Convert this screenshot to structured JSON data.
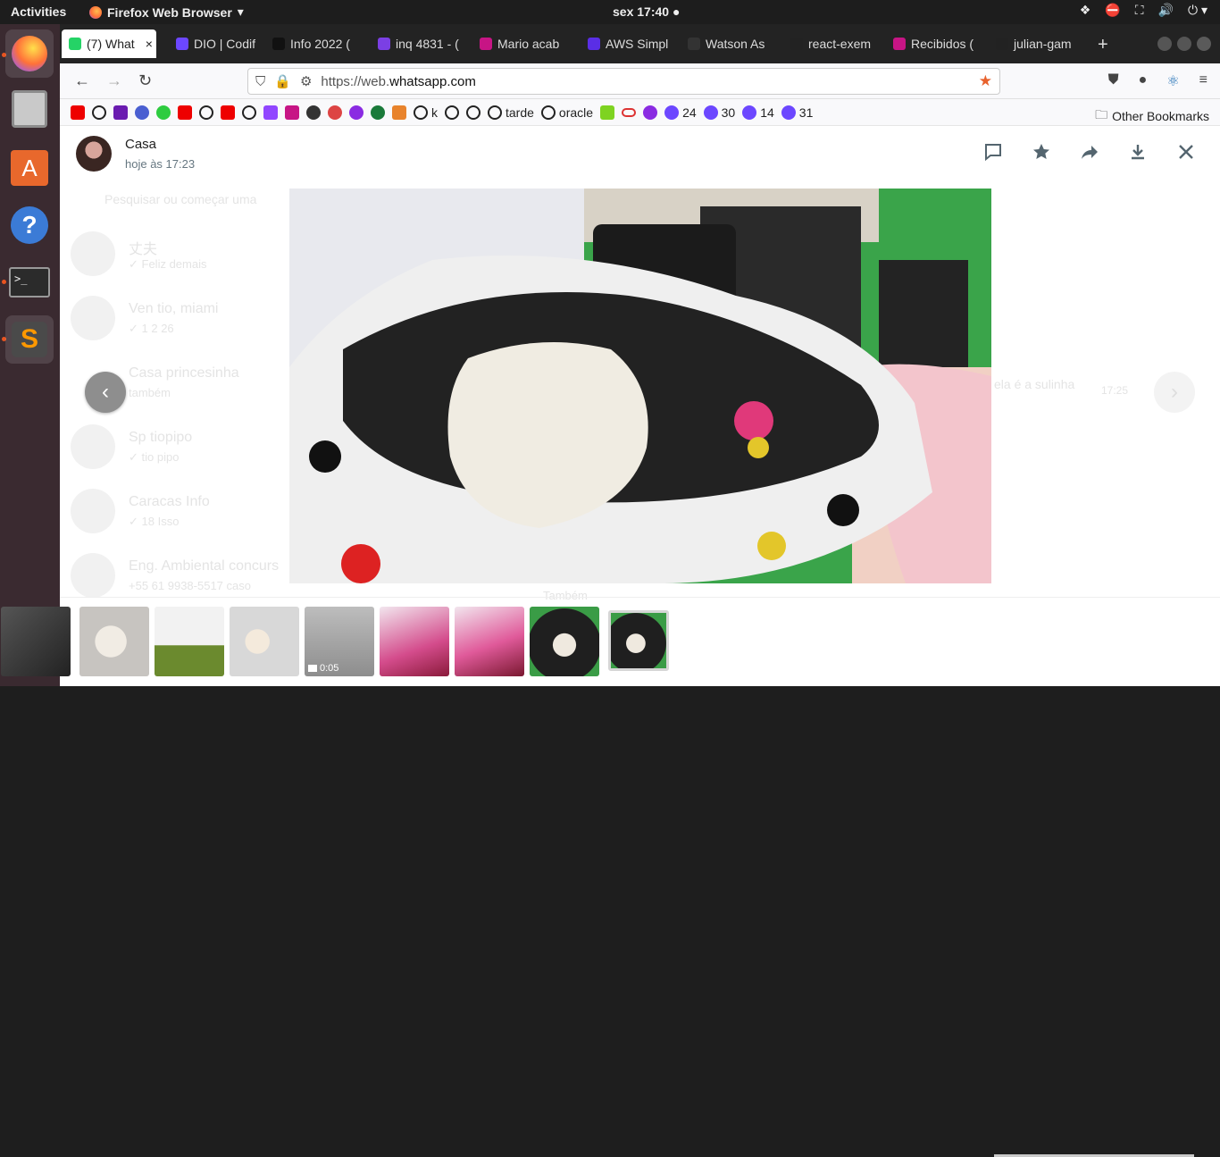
{
  "topbar": {
    "activities": "Activities",
    "app_name": "Firefox Web Browser",
    "clock": "sex 17:40"
  },
  "tabs": [
    {
      "label": "(7) What",
      "color": "#25d366"
    },
    {
      "label": "DIO | Codif",
      "color": "#6c47ff"
    },
    {
      "label": "Info 2022 (",
      "color": "#111111"
    },
    {
      "label": "inq 4831 - (",
      "color": "#7b3fe4"
    },
    {
      "label": "Mario acab",
      "color": "#c71585"
    },
    {
      "label": "AWS Simpl",
      "color": "#5a2ee6"
    },
    {
      "label": "Watson As",
      "color": "#333333"
    },
    {
      "label": "react-exem",
      "color": "#222222"
    },
    {
      "label": "Recibidos (",
      "color": "#c71585"
    },
    {
      "label": "julian-gam",
      "color": "#222222"
    }
  ],
  "tab_close": "×",
  "new_tab": "+",
  "nav": {
    "url_prefix": "https://web.",
    "url_domain": "whatsapp.com",
    "back": "←",
    "forward": "→",
    "reload": "↻",
    "star": "★"
  },
  "bookmarks": {
    "labels": [
      "k",
      "tarde",
      "oracle",
      "24",
      "30",
      "14",
      "31"
    ],
    "other": "Other Bookmarks"
  },
  "ghost_chats": [
    {
      "name": "丈夫",
      "preview": "✓ Feliz demais"
    },
    {
      "name": "Ven tio, miami",
      "preview": "✓ 1 2 26"
    },
    {
      "name": "Casa princesinha",
      "preview": "também"
    },
    {
      "name": "Sp tiopipo",
      "preview": "✓ tio pipo"
    },
    {
      "name": "Caracas Info",
      "preview": "✓ 18 Isso"
    },
    {
      "name": "Eng. Ambiental concurs",
      "preview": "+55 61 9938-5517 caso"
    }
  ],
  "ghost_search": "Pesquisar ou começar uma",
  "ghost_msg": "ela é a sulinha",
  "ghost_time": "17:25",
  "ghost_bottom": "Também",
  "viewer": {
    "contact_name": "Casa",
    "timestamp": "hoje às 17:23",
    "actions": [
      "comment-icon",
      "star-icon",
      "forward-icon",
      "download-icon",
      "close-icon"
    ]
  },
  "thumbnails": [
    {
      "kind": "photo",
      "theme": "dog-white"
    },
    {
      "kind": "photo",
      "theme": "dog-sweater"
    },
    {
      "kind": "photo",
      "theme": "dog-bowl"
    },
    {
      "kind": "video",
      "duration": "0:05"
    },
    {
      "kind": "photo",
      "theme": "dog-pink"
    },
    {
      "kind": "photo",
      "theme": "dog-pink2"
    },
    {
      "kind": "photo",
      "theme": "dog-bed"
    },
    {
      "kind": "photo",
      "theme": "dog-bed-selected"
    }
  ],
  "colors": {
    "accent": "#e95420",
    "whatsapp_green": "#25d366",
    "icon_gray": "#54656f"
  }
}
